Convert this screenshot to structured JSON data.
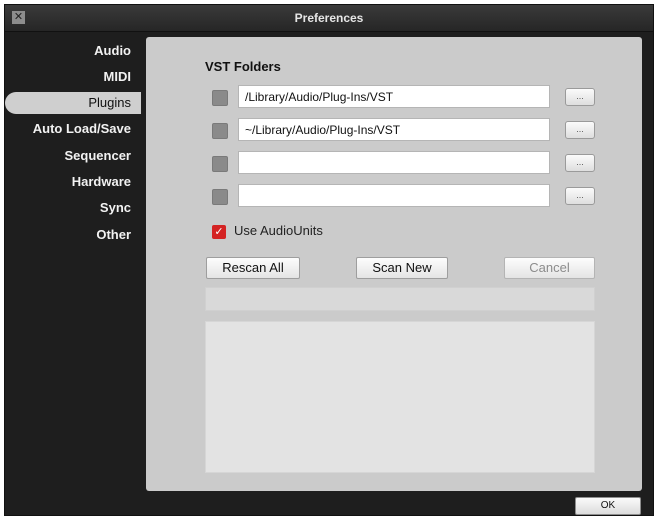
{
  "window": {
    "title": "Preferences",
    "close_glyph": "✕",
    "ok_label": "OK"
  },
  "sidebar": {
    "selected": "Plugins",
    "items": [
      {
        "label": "Audio"
      },
      {
        "label": "MIDI"
      },
      {
        "label": "Plugins"
      },
      {
        "label": "Auto Load/Save"
      },
      {
        "label": "Sequencer"
      },
      {
        "label": "Hardware"
      },
      {
        "label": "Sync"
      },
      {
        "label": "Other"
      }
    ]
  },
  "plugins": {
    "section_title": "VST Folders",
    "folders": [
      {
        "path": "/Library/Audio/Plug-Ins/VST",
        "enabled": false,
        "browse_label": "..."
      },
      {
        "path": "~/Library/Audio/Plug-Ins/VST",
        "enabled": false,
        "browse_label": "..."
      },
      {
        "path": "",
        "enabled": false,
        "browse_label": "..."
      },
      {
        "path": "",
        "enabled": false,
        "browse_label": "..."
      }
    ],
    "use_audiounits": {
      "label": "Use AudioUnits",
      "checked": true,
      "check_glyph": "✓"
    },
    "buttons": {
      "rescan_all": "Rescan All",
      "scan_new": "Scan New",
      "cancel": "Cancel"
    }
  },
  "colors": {
    "window_bg": "#1e1e1e",
    "panel_bg": "#cbcbcb",
    "selected_tab": "#cfcfcf",
    "checkbox_checked": "#d42323"
  },
  "icons": {
    "close": "close-icon",
    "check": "checkmark-icon"
  }
}
